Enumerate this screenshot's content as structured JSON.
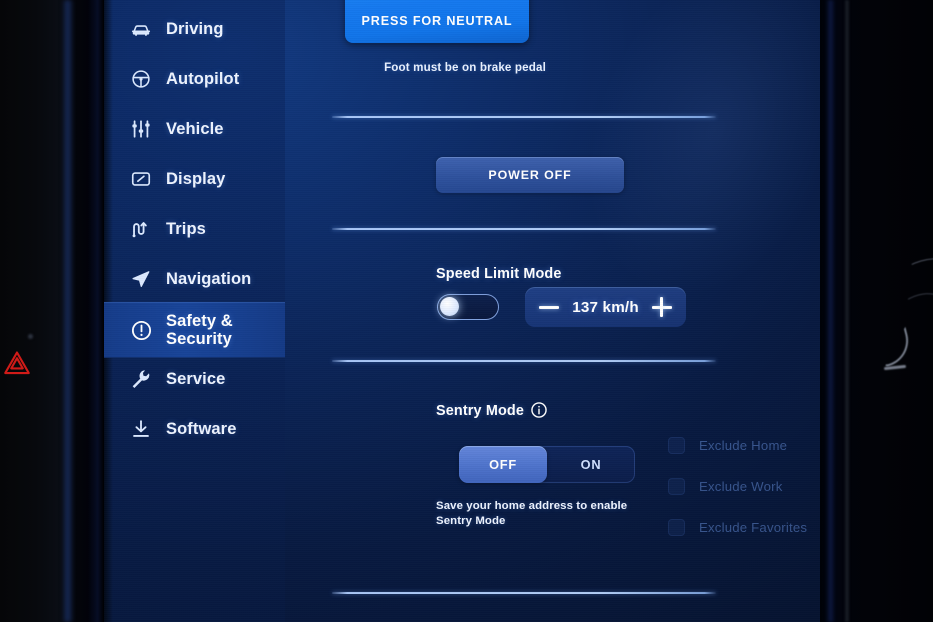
{
  "screen": {
    "accent_blue": "#1579ef",
    "background_navy": "#0b2457",
    "divider_color": "#b6d4ff"
  },
  "sidebar": {
    "items": [
      {
        "label": "Driving",
        "icon": "car-icon",
        "selected": false
      },
      {
        "label": "Autopilot",
        "icon": "steering-wheel-icon",
        "selected": false
      },
      {
        "label": "Vehicle",
        "icon": "sliders-icon",
        "selected": false
      },
      {
        "label": "Display",
        "icon": "display-icon",
        "selected": false
      },
      {
        "label": "Trips",
        "icon": "trips-icon",
        "selected": false
      },
      {
        "label": "Navigation",
        "icon": "navigation-icon",
        "selected": false
      },
      {
        "label": "Safety & Security",
        "icon": "alert-circle-icon",
        "selected": true
      },
      {
        "label": "Service",
        "icon": "wrench-icon",
        "selected": false
      },
      {
        "label": "Software",
        "icon": "download-icon",
        "selected": false
      }
    ]
  },
  "content": {
    "neutral_button": "PRESS FOR NEUTRAL",
    "brake_hint": "Foot must be on brake pedal",
    "power_off_button": "POWER OFF",
    "speed_limit": {
      "title": "Speed Limit Mode",
      "toggle_state": "off",
      "decrease_icon": "minus-icon",
      "increase_icon": "plus-icon",
      "value": "137 km/h"
    },
    "sentry": {
      "title": "Sentry Mode",
      "info_icon": "info-icon",
      "options": [
        {
          "label": "OFF",
          "active": true
        },
        {
          "label": "ON",
          "active": false
        }
      ],
      "hint": "Save your home address to enable Sentry Mode",
      "exclusions": [
        {
          "label": "Exclude Home",
          "checked": false,
          "enabled": false
        },
        {
          "label": "Exclude Work",
          "checked": false,
          "enabled": false
        },
        {
          "label": "Exclude Favorites",
          "checked": false,
          "enabled": false
        }
      ]
    }
  },
  "dashboard": {
    "hazard_button": "hazard-warning-triangle-icon",
    "hazard_color": "#d01b18"
  }
}
